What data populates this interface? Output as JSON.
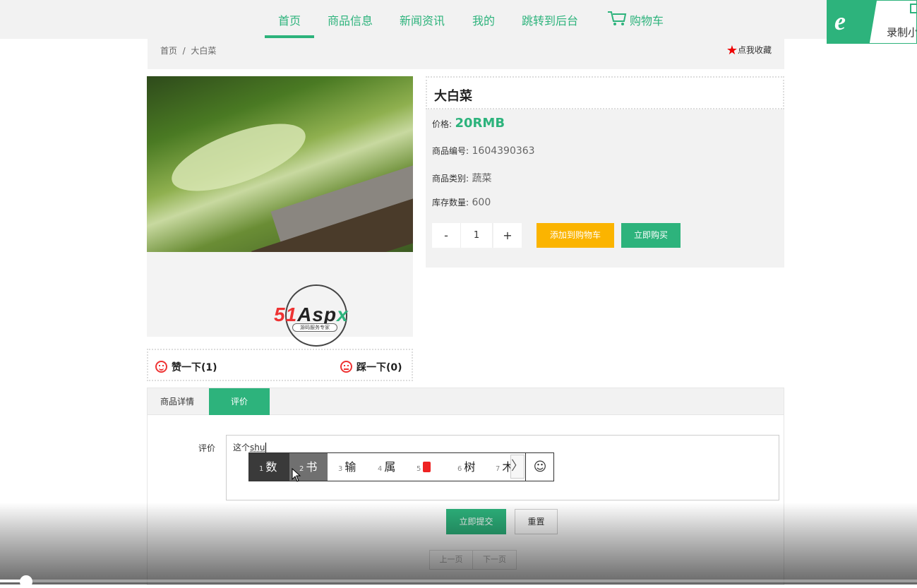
{
  "nav": {
    "items": [
      "首页",
      "商品信息",
      "新闻资讯",
      "我的",
      "跳转到后台"
    ],
    "cart_label": "购物车",
    "active_index": 0,
    "accent_color": "#2db37c"
  },
  "recorder_widget": {
    "label": "录制小"
  },
  "breadcrumb": {
    "home": "首页",
    "sep": "/",
    "current": "大白菜"
  },
  "favorite": {
    "star": "★",
    "label": "点我收藏"
  },
  "logo": {
    "p1": "51",
    "p2": "Asp",
    "p3": "x",
    "sub": "源码服务专家"
  },
  "votes": {
    "like_label": "赞一下(1)",
    "dislike_label": "踩一下(0)"
  },
  "product": {
    "name": "大白菜",
    "price_label": "价格:",
    "price": "20RMB",
    "id_label": "商品编号:",
    "id": "1604390363",
    "category_label": "商品类别:",
    "category": "蔬菜",
    "stock_label": "库存数量:",
    "stock": "600"
  },
  "quantity": {
    "minus": "-",
    "value": "1",
    "plus": "+"
  },
  "buttons": {
    "add_cart": "添加到购物车",
    "buy_now": "立即购买",
    "submit": "立即提交",
    "reset": "重置"
  },
  "tabs": [
    "商品详情",
    "评价"
  ],
  "active_tab": 1,
  "comment": {
    "label": "评价",
    "text_prefix": "这个",
    "composing": "shu"
  },
  "ime": {
    "candidates": [
      {
        "n": "1",
        "t": "数"
      },
      {
        "n": "2",
        "t": "书"
      },
      {
        "n": "3",
        "t": "输"
      },
      {
        "n": "4",
        "t": "属"
      },
      {
        "n": "5",
        "t": ""
      },
      {
        "n": "6",
        "t": "树"
      },
      {
        "n": "7",
        "t": "木"
      }
    ],
    "next": "〉",
    "emoji": "☺"
  },
  "pager": {
    "prev": "上一页",
    "next": "下一页"
  },
  "video": {
    "progress": 0.03
  }
}
